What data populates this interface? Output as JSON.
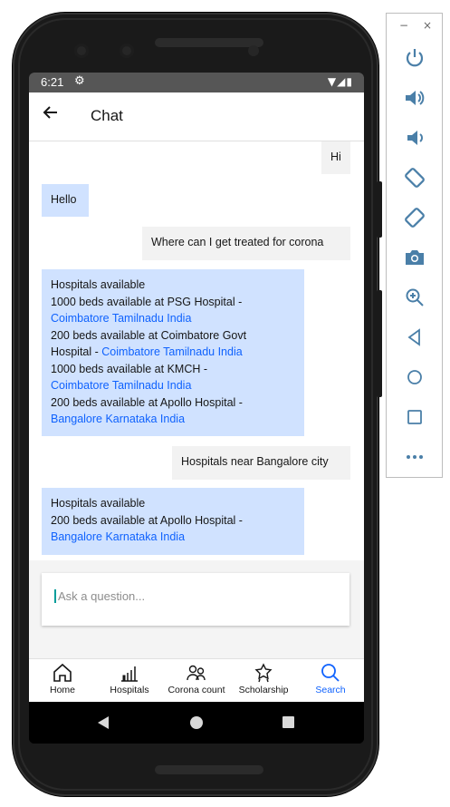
{
  "status_bar": {
    "time": "6:21",
    "settings_icon": "gear-icon",
    "system_icons": "wifi signal battery"
  },
  "app_bar": {
    "back_icon": "arrow-left-icon",
    "title": "Chat"
  },
  "messages": [
    {
      "sender": "user",
      "lines": [
        {
          "text": "Hi"
        }
      ]
    },
    {
      "sender": "bot",
      "lines": [
        {
          "text": "Hello"
        }
      ]
    },
    {
      "sender": "user",
      "lines": [
        {
          "text": "Where can I get treated for corona"
        }
      ]
    },
    {
      "sender": "bot",
      "lines": [
        {
          "text": "Hospitals available"
        },
        {
          "text": " 1000 beds available at PSG Hospital -"
        },
        {
          "link": "Coimbatore Tamilnadu India"
        },
        {
          "text": " 200 beds available at Coimbatore Govt"
        },
        {
          "text": "Hospital - ",
          "link": " Coimbatore Tamilnadu India"
        },
        {
          "text": " 1000 beds available at KMCH  -"
        },
        {
          "link": "Coimbatore Tamilnadu India"
        },
        {
          "text": " 200 beds available at Apollo Hospital -"
        },
        {
          "link": "Bangalore Karnataka India"
        }
      ]
    },
    {
      "sender": "user",
      "lines": [
        {
          "text": "Hospitals near Bangalore city"
        }
      ]
    },
    {
      "sender": "bot",
      "lines": [
        {
          "text": "Hospitals available"
        },
        {
          "text": " 200 beds available at Apollo Hospital -"
        },
        {
          "link": "Bangalore Karnataka India"
        }
      ]
    }
  ],
  "input": {
    "placeholder": "Ask a question...",
    "value": ""
  },
  "tabs": [
    {
      "label": "Home",
      "icon": "home-icon",
      "active": false
    },
    {
      "label": "Hospitals",
      "icon": "bar-chart-icon",
      "active": false
    },
    {
      "label": "Corona count",
      "icon": "people-icon",
      "active": false
    },
    {
      "label": "Scholarship",
      "icon": "award-icon",
      "active": false
    },
    {
      "label": "Search",
      "icon": "search-icon",
      "active": true
    }
  ],
  "colors": {
    "accent": "#0f62fe",
    "bot_bubble": "#d0e2ff",
    "user_bubble": "#f2f2f2",
    "cursor": "#009d9a",
    "toolbar_icon": "#4a7fa8"
  },
  "emulator_toolbar": {
    "window_controls": {
      "minimize": "−",
      "close": "×"
    },
    "tools": [
      "power-icon",
      "volume-up-icon",
      "volume-down-icon",
      "rotate-left-icon",
      "rotate-right-icon",
      "camera-icon",
      "zoom-in-icon",
      "back-icon",
      "home-icon",
      "overview-icon",
      "more-icon"
    ]
  }
}
